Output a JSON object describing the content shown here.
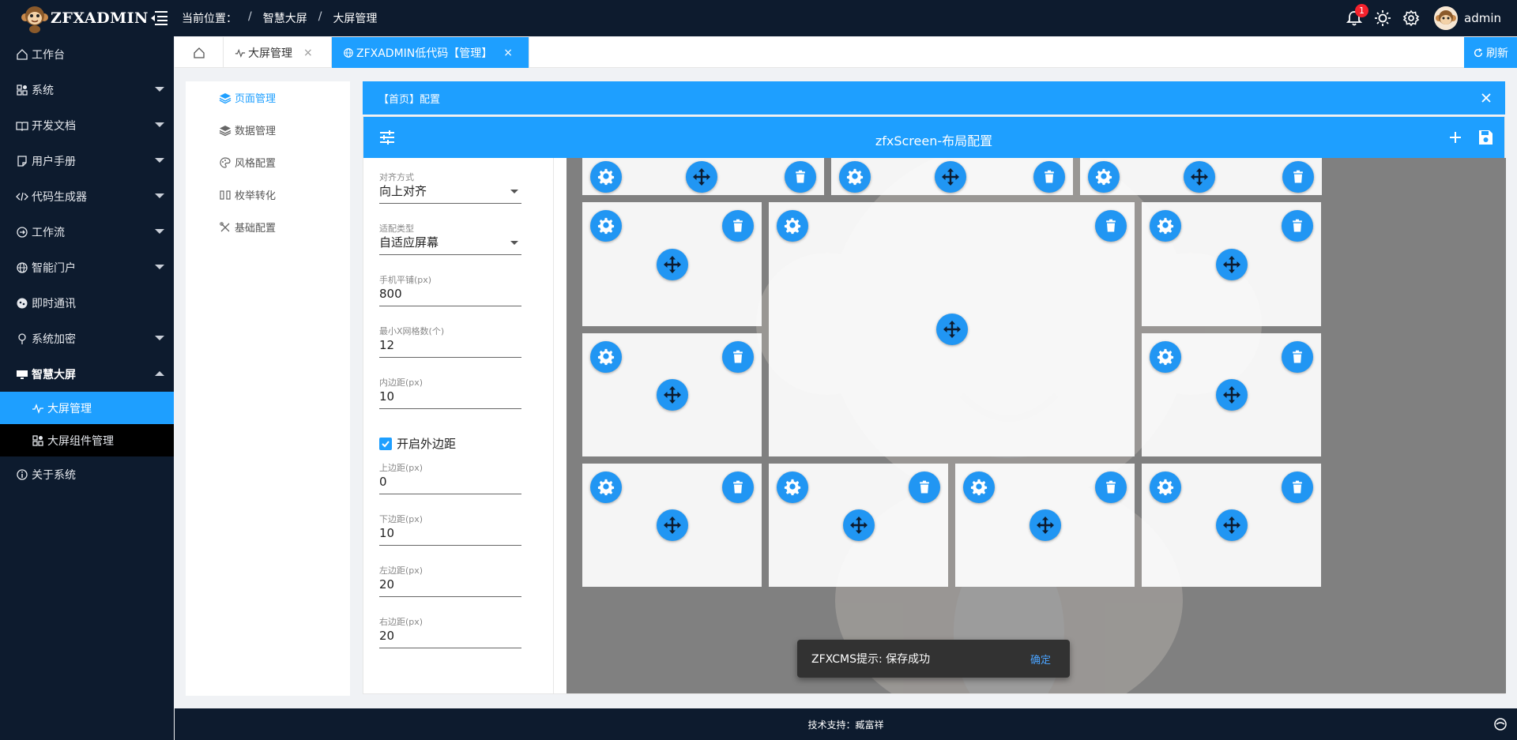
{
  "app": {
    "brand": "ZFXADMIN"
  },
  "breadcrumb": {
    "prefix": "当前位置：",
    "sep": "/",
    "items": [
      "智慧大屏",
      "大屏管理"
    ]
  },
  "header": {
    "notification_count": "1",
    "username": "admin"
  },
  "sidebar": {
    "items": [
      {
        "label": "工作台"
      },
      {
        "label": "系统"
      },
      {
        "label": "开发文档"
      },
      {
        "label": "用户手册"
      },
      {
        "label": "代码生成器"
      },
      {
        "label": "工作流"
      },
      {
        "label": "智能门户"
      },
      {
        "label": "即时通讯"
      },
      {
        "label": "系统加密"
      },
      {
        "label": "智慧大屏"
      },
      {
        "label": "关于系统"
      }
    ],
    "sub_items": [
      {
        "label": "大屏管理"
      },
      {
        "label": "大屏组件管理"
      }
    ]
  },
  "tabs": {
    "items": [
      {
        "label": "大屏管理",
        "close": "×"
      },
      {
        "label": "ZFXADMIN低代码【管理】",
        "close": "×"
      }
    ],
    "refresh_label": "刷新"
  },
  "left_menu": {
    "items": [
      {
        "label": "页面管理"
      },
      {
        "label": "数据管理"
      },
      {
        "label": "风格配置"
      },
      {
        "label": "枚举转化"
      },
      {
        "label": "基础配置"
      }
    ]
  },
  "config": {
    "header_title": "【首页】配置",
    "toolbar_title": "zfxScreen-布局配置"
  },
  "form": {
    "align": {
      "label": "对齐方式",
      "value": "向上对齐"
    },
    "fit": {
      "label": "适配类型",
      "value": "自适应屏幕"
    },
    "mobile": {
      "label": "手机平铺(px)",
      "value": "800"
    },
    "min_x": {
      "label": "最小X网格数(个)",
      "value": "12"
    },
    "padding": {
      "label": "内边距(px)",
      "value": "10"
    },
    "margin_toggle": {
      "label": "开启外边距",
      "checked": true
    },
    "top": {
      "label": "上边距(px)",
      "value": "0"
    },
    "bottom": {
      "label": "下边距(px)",
      "value": "10"
    },
    "left": {
      "label": "左边距(px)",
      "value": "20"
    },
    "right": {
      "label": "右边距(px)",
      "value": "20"
    }
  },
  "toast": {
    "message": "ZFXCMS提示: 保存成功",
    "action": "确定"
  },
  "footer": {
    "text": "技术支持：臧富祥"
  },
  "colors": {
    "primary": "#1e9fff",
    "nav_bg": "#0d1b2e",
    "grid_bg": "#808080",
    "fab": "#2196f3"
  }
}
